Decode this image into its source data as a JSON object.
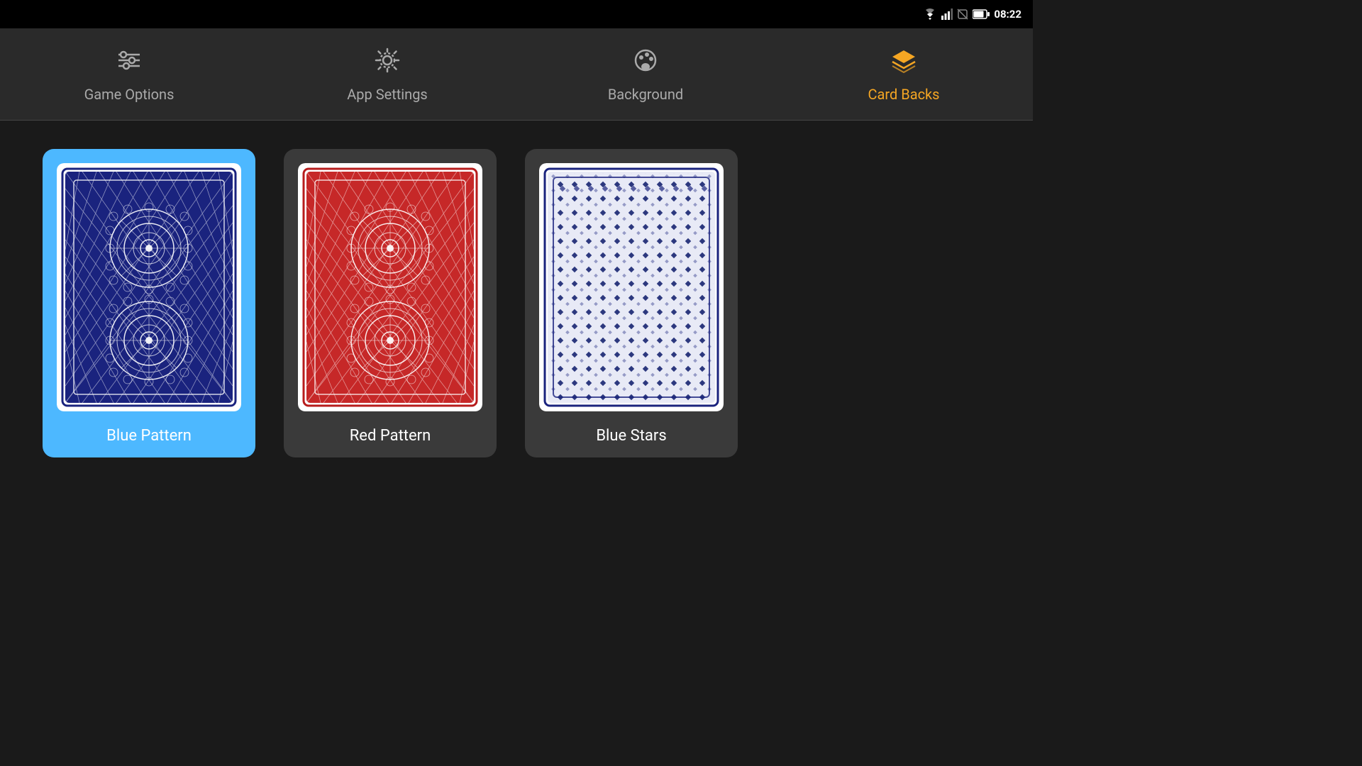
{
  "statusBar": {
    "time": "08:22"
  },
  "navTabs": [
    {
      "id": "game-options",
      "label": "Game Options",
      "icon": "sliders",
      "active": false
    },
    {
      "id": "app-settings",
      "label": "App Settings",
      "icon": "gear",
      "active": false
    },
    {
      "id": "background",
      "label": "Background",
      "icon": "palette",
      "active": false
    },
    {
      "id": "card-backs",
      "label": "Card Backs",
      "icon": "layers",
      "active": true
    }
  ],
  "cardBacks": [
    {
      "id": "blue-pattern",
      "label": "Blue Pattern",
      "selected": true,
      "color": "blue"
    },
    {
      "id": "red-pattern",
      "label": "Red Pattern",
      "selected": false,
      "color": "red"
    },
    {
      "id": "blue-stars",
      "label": "Blue Stars",
      "selected": false,
      "color": "blue-stars"
    }
  ],
  "colors": {
    "accent": "#f5a623",
    "selectedBg": "#4db8ff",
    "inactiveBg": "#3a3a3a",
    "tabBg": "#2a2a2a",
    "bodyBg": "#1a1a1a"
  }
}
